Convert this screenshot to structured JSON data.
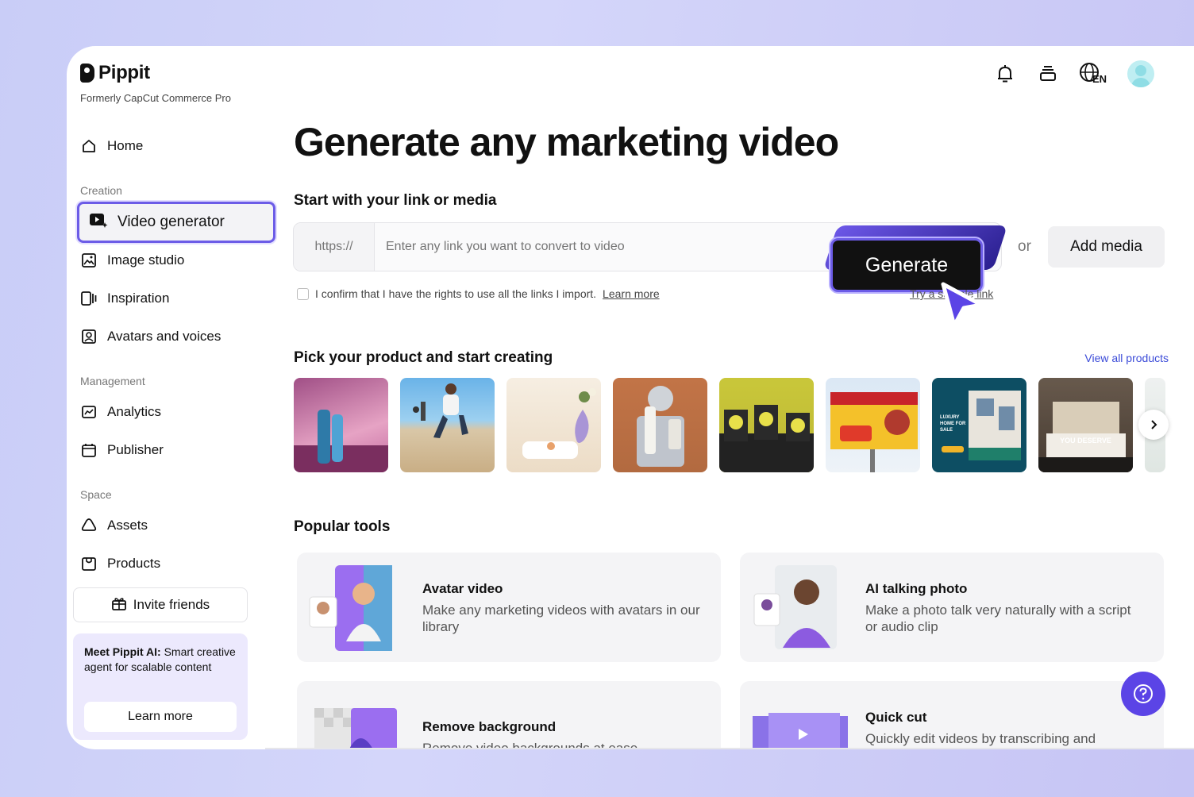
{
  "brand": {
    "name": "Pippit",
    "subtitle": "Formerly CapCut Commerce Pro"
  },
  "sidebar": {
    "home": "Home",
    "sections": {
      "creation": "Creation",
      "management": "Management",
      "space": "Space"
    },
    "items": {
      "video_generator": "Video generator",
      "image_studio": "Image studio",
      "inspiration": "Inspiration",
      "avatars_voices": "Avatars and voices",
      "analytics": "Analytics",
      "publisher": "Publisher",
      "assets": "Assets",
      "products": "Products"
    },
    "invite": "Invite friends",
    "promo": {
      "bold": "Meet Pippit AI:",
      "text": " Smart creative agent for scalable content",
      "button": "Learn more"
    }
  },
  "header": {
    "lang": "EN",
    "icons": [
      "bell-icon",
      "stack-icon",
      "globe-icon"
    ]
  },
  "main": {
    "title": "Generate any marketing video",
    "link_section": "Start with your link or media",
    "prefix": "https://",
    "placeholder": "Enter any link you want to convert to video",
    "generate": "Generate",
    "or": "or",
    "add_media": "Add media",
    "confirm_text": "I confirm that I have the rights to use all the links I import.",
    "learn_more": "Learn more",
    "try_link": "Try a sample link",
    "products_title": "Pick your product and start creating",
    "view_all": "View all products",
    "popular_title": "Popular tools",
    "tools": [
      {
        "title": "Avatar video",
        "desc": "Make any marketing videos with avatars in our library"
      },
      {
        "title": "AI talking photo",
        "desc": "Make a photo talk very naturally with a script or audio clip"
      },
      {
        "title": "Remove background",
        "desc": "Remove video backgrounds at ease"
      },
      {
        "title": "Quick cut",
        "desc": "Quickly edit videos by transcribing and"
      }
    ],
    "thumb_texts": {
      "home": "LUXURY HOME FOR SALE",
      "deserve": "YOU DESERVE"
    }
  },
  "colors": {
    "accent": "#6c5ce7",
    "help": "#5b44e6",
    "link": "#3b4bd8"
  }
}
